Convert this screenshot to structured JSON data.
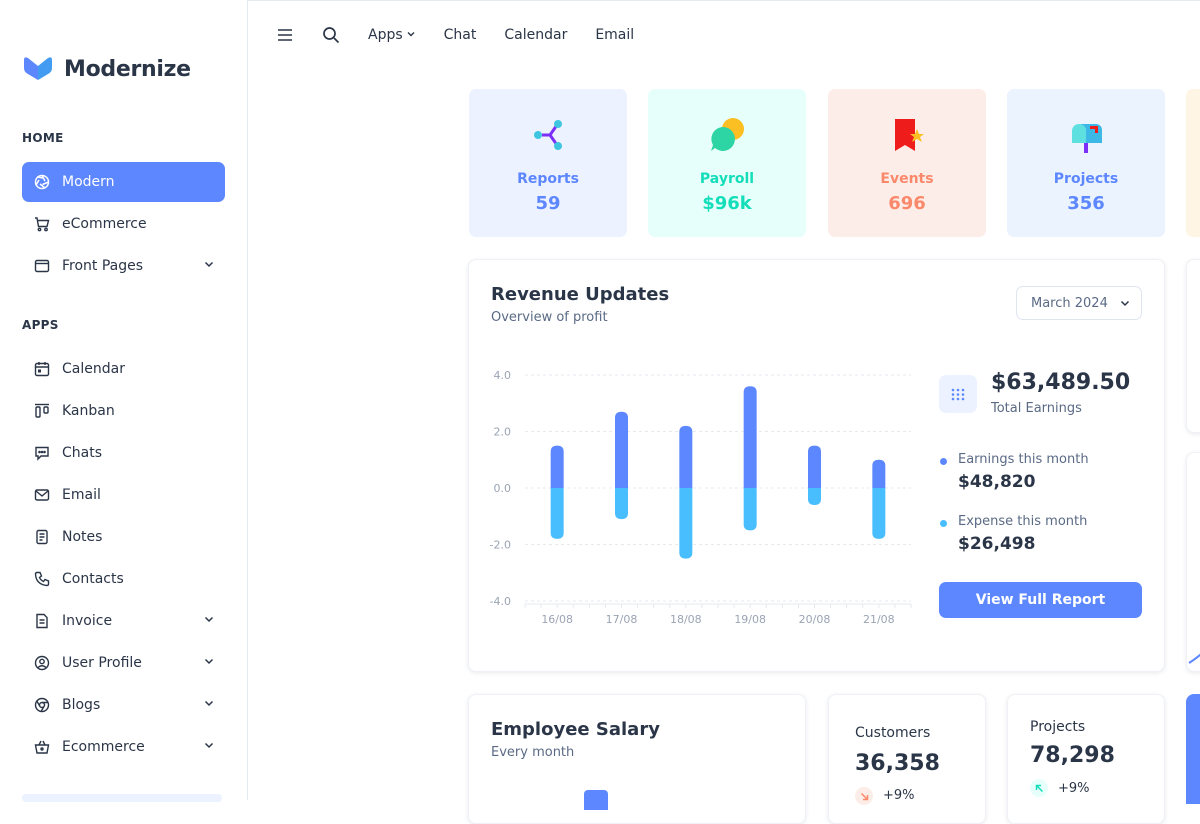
{
  "brand": {
    "name": "Modernize",
    "accent": "#5d87ff"
  },
  "sidebar": {
    "sections": [
      {
        "title": "HOME"
      },
      {
        "title": "APPS"
      }
    ],
    "items": [
      {
        "label": "Modern",
        "icon": "aperture-icon",
        "active": true
      },
      {
        "label": "eCommerce",
        "icon": "cart-icon"
      },
      {
        "label": "Front Pages",
        "icon": "layout-icon",
        "chevron": true
      },
      {
        "label": "Calendar",
        "icon": "calendar-icon"
      },
      {
        "label": "Kanban",
        "icon": "kanban-icon"
      },
      {
        "label": "Chats",
        "icon": "message-icon"
      },
      {
        "label": "Email",
        "icon": "mail-icon"
      },
      {
        "label": "Notes",
        "icon": "notes-icon"
      },
      {
        "label": "Contacts",
        "icon": "phone-icon"
      },
      {
        "label": "Invoice",
        "icon": "file-text-icon",
        "chevron": true
      },
      {
        "label": "User Profile",
        "icon": "user-circle-icon",
        "chevron": true
      },
      {
        "label": "Blogs",
        "icon": "chrome-icon",
        "chevron": true
      },
      {
        "label": "Ecommerce",
        "icon": "basket-icon",
        "chevron": true
      }
    ]
  },
  "topbar": {
    "links": [
      "Apps",
      "Chat",
      "Calendar",
      "Email"
    ]
  },
  "stats": [
    {
      "label": "Reports",
      "value": "59",
      "color": "#5d87ff",
      "bg": "#ecf2ff",
      "icon": "share-icon"
    },
    {
      "label": "Payroll",
      "value": "$96k",
      "color": "#13deb9",
      "bg": "#e6fffa",
      "icon": "speech-bubbles-icon"
    },
    {
      "label": "Events",
      "value": "696",
      "color": "#fa896b",
      "bg": "#fdede8",
      "icon": "ribbon-star-icon"
    },
    {
      "label": "Projects",
      "value": "356",
      "color": "#5d87ff",
      "bg": "#ebf3fe",
      "icon": "mailbox-icon"
    }
  ],
  "revenue": {
    "title": "Revenue Updates",
    "subtitle": "Overview of profit",
    "month": "March 2024",
    "total": "$63,489.50",
    "total_label": "Total Earnings",
    "earnings_label": "Earnings this month",
    "earnings_value": "$48,820",
    "expense_label": "Expense this month",
    "expense_value": "$26,498",
    "button": "View Full Report"
  },
  "chart_data": {
    "type": "bar",
    "categories": [
      "16/08",
      "17/08",
      "18/08",
      "19/08",
      "20/08",
      "21/08"
    ],
    "series": [
      {
        "name": "Earnings this month",
        "values": [
          1.5,
          2.7,
          2.2,
          3.6,
          1.5,
          1.0
        ],
        "color": "#5d87ff"
      },
      {
        "name": "Expense this month",
        "values": [
          -1.8,
          -1.1,
          -2.5,
          -1.5,
          -0.6,
          -1.8
        ],
        "color": "#49beff"
      }
    ],
    "yticks": [
      "4.0",
      "2.0",
      "0.0",
      "-2.0",
      "-4.0"
    ],
    "ylim": [
      -4,
      4
    ],
    "grid": true
  },
  "salary": {
    "title": "Employee Salary",
    "subtitle": "Every month"
  },
  "customers": {
    "label": "Customers",
    "value": "36,358",
    "change": "+9%"
  },
  "projects": {
    "label": "Projects",
    "value": "78,298",
    "change": "+9%"
  }
}
